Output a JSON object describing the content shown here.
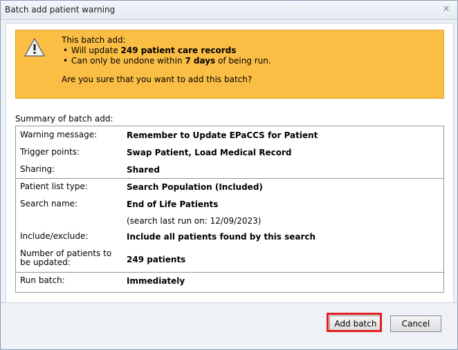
{
  "dialog": {
    "title": "Batch add patient warning",
    "close_icon": "close-icon"
  },
  "warning": {
    "icon": "warning-triangle-icon",
    "intro": "This batch add:",
    "bullet1_pre": "Will update ",
    "bullet1_bold": "249 patient care records",
    "bullet2_pre": "Can only be undone within ",
    "bullet2_bold": "7 days",
    "bullet2_post": " of being run.",
    "question": "Are you sure that you want to add this batch?",
    "color": "#fbbe45"
  },
  "summary": {
    "heading": "Summary of batch add:",
    "warning_message_label": "Warning message:",
    "warning_message_value": "Remember to Update EPaCCS for Patient",
    "trigger_points_label": "Trigger points:",
    "trigger_points_value": "Swap Patient, Load Medical Record",
    "sharing_label": "Sharing:",
    "sharing_value": "Shared",
    "patient_list_type_label": "Patient list type:",
    "patient_list_type_value": "Search Population (Included)",
    "search_name_label": "Search name:",
    "search_name_value": "End of Life Patients",
    "search_last_run": "(search last run on: 12/09/2023)",
    "include_exclude_label": "Include/exclude:",
    "include_exclude_value": "Include all patients found by this search",
    "num_patients_label": "Number of patients to be updated:",
    "num_patients_value": "249 patients",
    "run_batch_label": "Run batch:",
    "run_batch_value": "Immediately"
  },
  "buttons": {
    "add_batch": "Add batch",
    "cancel": "Cancel",
    "highlight_color": "#e21d1d"
  }
}
